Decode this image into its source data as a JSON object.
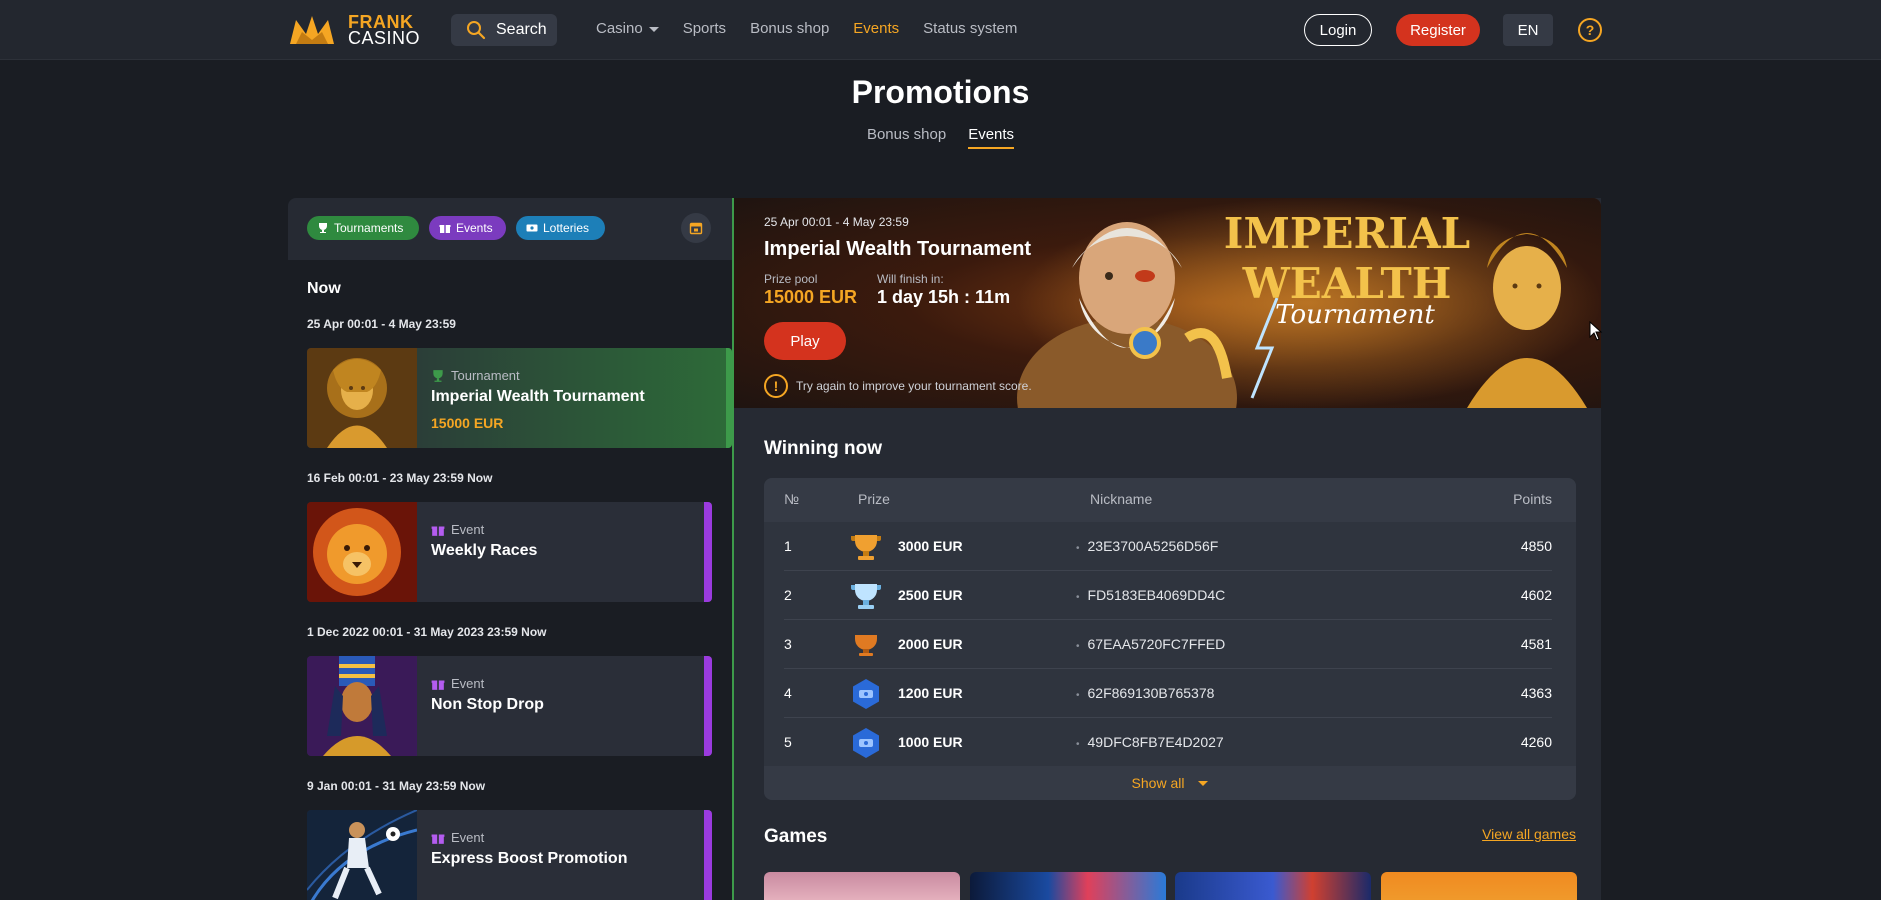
{
  "header": {
    "logo_line1": "FRANK",
    "logo_line2": "CASINO",
    "search_label": "Search",
    "nav": [
      {
        "label": "Casino",
        "active": false,
        "dropdown": true
      },
      {
        "label": "Sports",
        "active": false
      },
      {
        "label": "Bonus shop",
        "active": false
      },
      {
        "label": "Events",
        "active": true
      },
      {
        "label": "Status system",
        "active": false
      }
    ],
    "login_label": "Login",
    "register_label": "Register",
    "lang_label": "EN",
    "help_label": "?"
  },
  "page": {
    "title": "Promotions",
    "tabs": [
      {
        "label": "Bonus shop",
        "active": false
      },
      {
        "label": "Events",
        "active": true
      }
    ]
  },
  "filters": {
    "chips": [
      "Tournaments",
      "Events",
      "Lotteries"
    ]
  },
  "list": {
    "now_label": "Now",
    "items": [
      {
        "dates": "25 Apr 00:01 - 4 May 23:59",
        "type": "Tournament",
        "name": "Imperial Wealth Tournament",
        "prize": "15000 EUR"
      },
      {
        "dates": "16 Feb 00:01 - 23 May 23:59 Now",
        "type": "Event",
        "name": "Weekly Races",
        "prize": ""
      },
      {
        "dates": "1 Dec 2022 00:01 - 31 May 2023 23:59 Now",
        "type": "Event",
        "name": "Non Stop Drop",
        "prize": ""
      },
      {
        "dates": "9 Jan 00:01 - 31 May 23:59 Now",
        "type": "Event",
        "name": "Express Boost Promotion",
        "prize": ""
      }
    ]
  },
  "banner": {
    "dates": "25 Apr 00:01 - 4 May 23:59",
    "title": "Imperial Wealth Tournament",
    "prize_pool_label": "Prize pool",
    "prize_pool_value": "15000 EUR",
    "finish_label": "Will finish in:",
    "finish_value": "1 day 15h : 11m",
    "play_label": "Play",
    "hint": "Try again to improve your tournament score.",
    "art_title_1": "IMPERIAL",
    "art_title_2": "WEALTH",
    "art_subtitle": "Tournament"
  },
  "winning": {
    "title": "Winning now",
    "columns": [
      "№",
      "Prize",
      "Nickname",
      "Points"
    ],
    "rows": [
      {
        "num": "1",
        "prize": "3000 EUR",
        "nickname": "23E3700A5256D56F",
        "points": "4850",
        "icon": "gold-trophy-icon"
      },
      {
        "num": "2",
        "prize": "2500 EUR",
        "nickname": "FD5183EB4069DD4C",
        "points": "4602",
        "icon": "silver-trophy-icon"
      },
      {
        "num": "3",
        "prize": "2000 EUR",
        "nickname": "67EAA5720FC7FFED",
        "points": "4581",
        "icon": "bronze-trophy-icon"
      },
      {
        "num": "4",
        "prize": "1200 EUR",
        "nickname": "62F869130B765378",
        "points": "4363",
        "icon": "medal-icon"
      },
      {
        "num": "5",
        "prize": "1000 EUR",
        "nickname": "49DFC8FB7E4D2027",
        "points": "4260",
        "icon": "medal-icon"
      }
    ],
    "show_all_label": "Show all"
  },
  "games": {
    "title": "Games",
    "view_all_label": "View all games"
  },
  "colors": {
    "accent": "#f5a623",
    "register": "#d4331e",
    "tournament_chip": "#2f8a3f",
    "event_chip": "#7b3bbf",
    "lottery_chip": "#1d7fb8"
  }
}
